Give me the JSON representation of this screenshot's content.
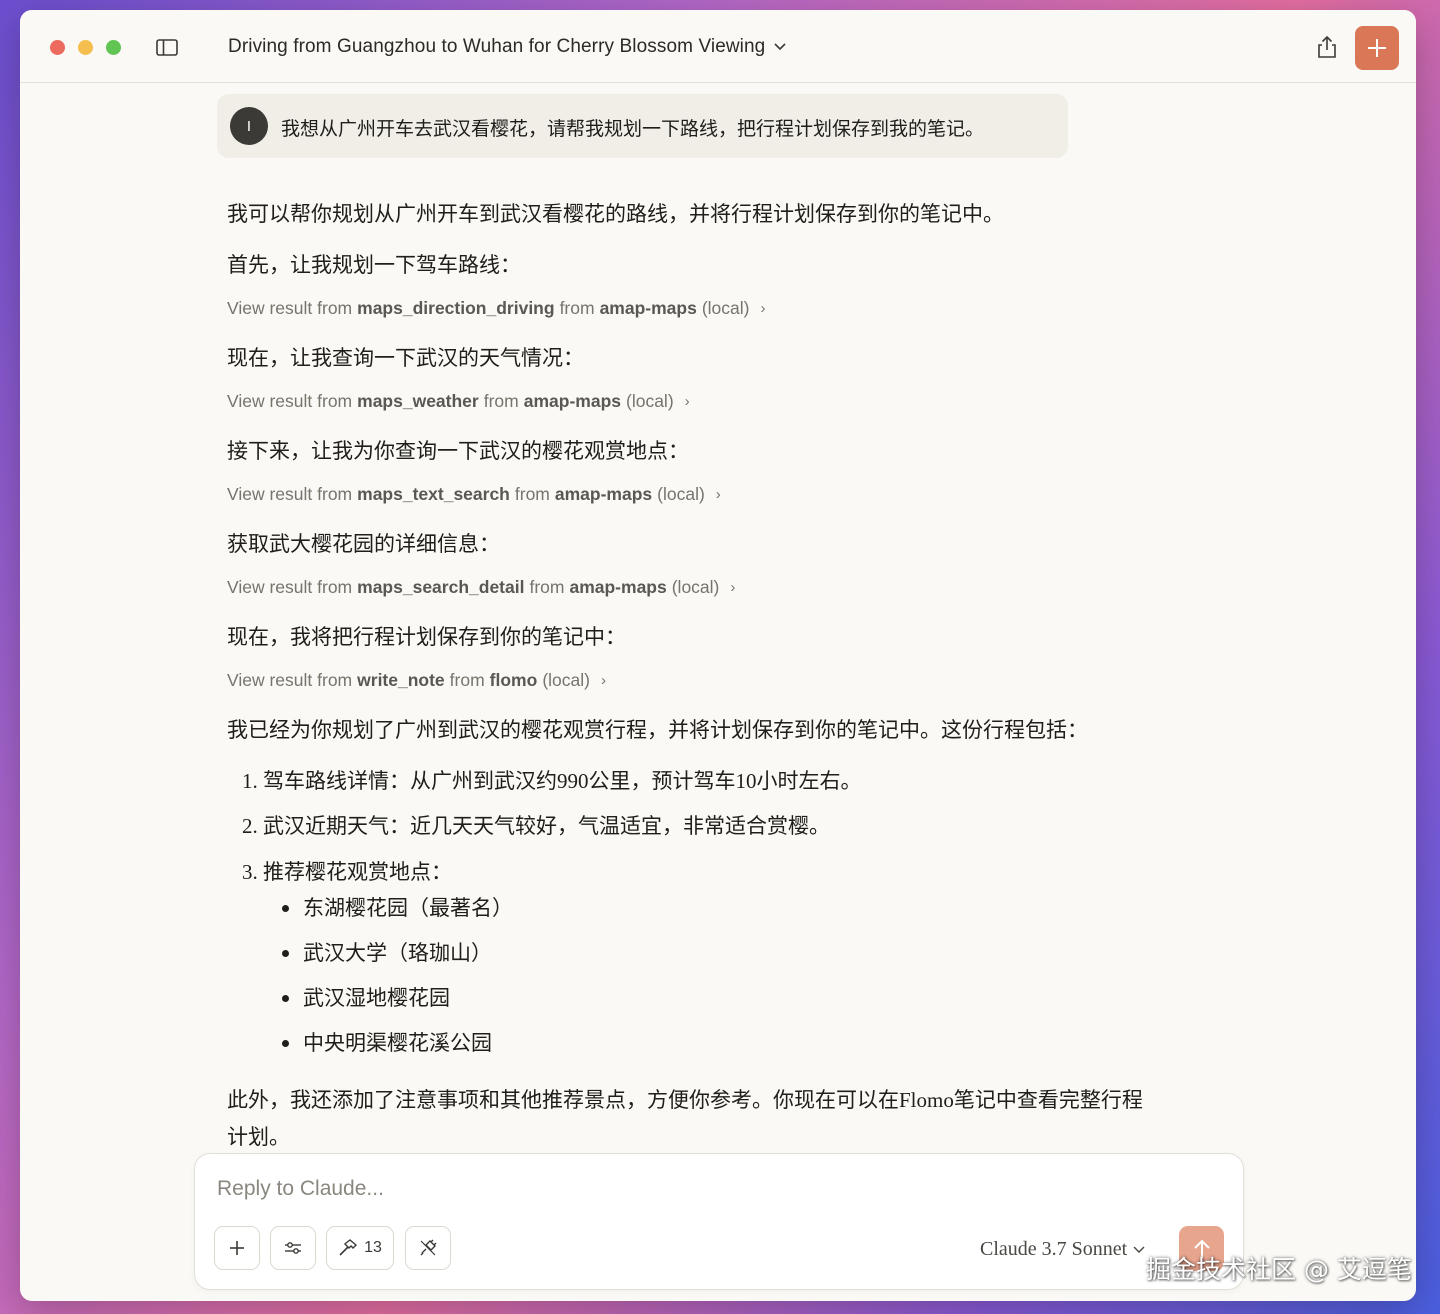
{
  "window": {
    "title": "Driving from Guangzhou to Wuhan for Cherry Blossom Viewing",
    "accent_color": "#d97757"
  },
  "user_message": {
    "avatar_initial": "I",
    "text": "我想从广州开车去武汉看樱花，请帮我规划一下路线，把行程计划保存到我的笔记。"
  },
  "assistant": {
    "intro": "我可以帮你规划从广州开车到武汉看樱花的路线，并将行程计划保存到你的笔记中。",
    "step1": "首先，让我规划一下驾车路线：",
    "tool1": {
      "prefix": "View result from",
      "tool": "maps_direction_driving",
      "from": "from",
      "server": "amap-maps",
      "scope": "(local)"
    },
    "step2": "现在，让我查询一下武汉的天气情况：",
    "tool2": {
      "prefix": "View result from",
      "tool": "maps_weather",
      "from": "from",
      "server": "amap-maps",
      "scope": "(local)"
    },
    "step3": "接下来，让我为你查询一下武汉的樱花观赏地点：",
    "tool3": {
      "prefix": "View result from",
      "tool": "maps_text_search",
      "from": "from",
      "server": "amap-maps",
      "scope": "(local)"
    },
    "step4": "获取武大樱花园的详细信息：",
    "tool4": {
      "prefix": "View result from",
      "tool": "maps_search_detail",
      "from": "from",
      "server": "amap-maps",
      "scope": "(local)"
    },
    "step5": "现在，我将把行程计划保存到你的笔记中：",
    "tool5": {
      "prefix": "View result from",
      "tool": "write_note",
      "from": "from",
      "server": "flomo",
      "scope": "(local)"
    },
    "summary": "我已经为你规划了广州到武汉的樱花观赏行程，并将计划保存到你的笔记中。这份行程包括：",
    "list": [
      "1. 驾车路线详情：从广州到武汉约990公里，预计驾车10小时左右。",
      "2. 武汉近期天气：近几天天气较好，气温适宜，非常适合赏樱。",
      "3. 推荐樱花观赏地点："
    ],
    "spots": [
      "东湖樱花园（最著名）",
      "武汉大学（珞珈山）",
      "武汉湿地樱花园",
      "中央明渠樱花溪公园"
    ],
    "closing_line1": "此外，我还添加了注意事项和其他推荐景点，方便你参考。你现在可以在Flomo笔记中查看完整行程",
    "closing_line2": "计划。"
  },
  "composer": {
    "placeholder": "Reply to Claude...",
    "tools_count": "13",
    "model": "Claude 3.7 Sonnet"
  },
  "watermark": "掘金技术社区 @ 艾逗笔"
}
